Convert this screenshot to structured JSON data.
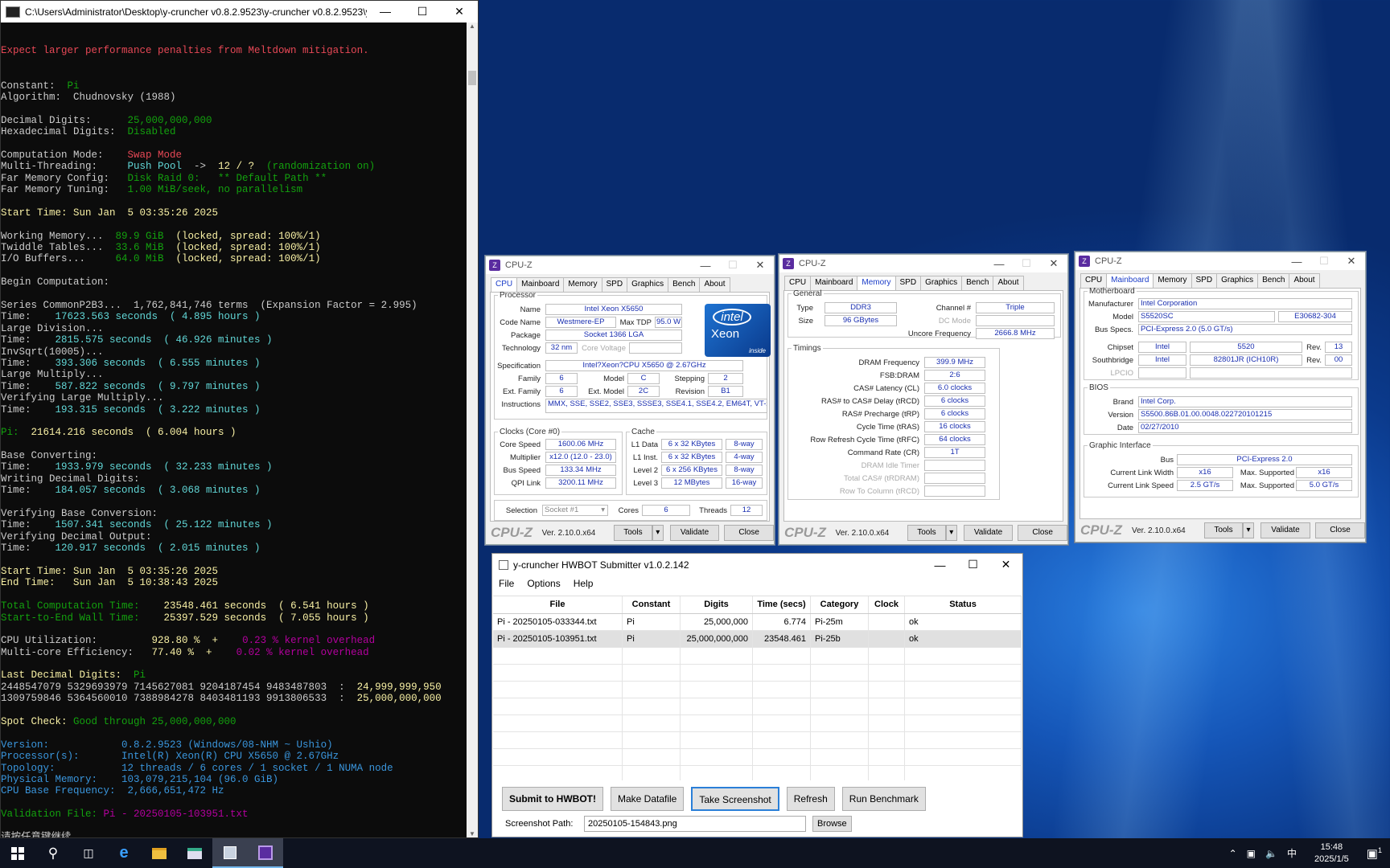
{
  "console": {
    "title": "C:\\Users\\Administrator\\Desktop\\y-cruncher v0.8.2.9523\\y-cruncher v0.8.2.9523\\y-cr...",
    "lines": [
      [
        [
          "",
          "w"
        ]
      ],
      [
        [
          "Expect larger performance penalties from Meltdown mitigation.",
          "r"
        ]
      ],
      [
        [
          "",
          "w"
        ]
      ],
      [
        [
          "",
          "w"
        ]
      ],
      [
        [
          "Constant:  ",
          "w"
        ],
        [
          "Pi",
          "g"
        ]
      ],
      [
        [
          "Algorithm:  Chudnovsky (1988)",
          "w"
        ]
      ],
      [
        [
          "",
          "w"
        ]
      ],
      [
        [
          "Decimal Digits:      ",
          "w"
        ],
        [
          "25,000,000,000",
          "g"
        ]
      ],
      [
        [
          "Hexadecimal Digits:  ",
          "w"
        ],
        [
          "Disabled",
          "g"
        ]
      ],
      [
        [
          "",
          "w"
        ]
      ],
      [
        [
          "Computation Mode:    ",
          "w"
        ],
        [
          "Swap Mode",
          "r"
        ]
      ],
      [
        [
          "Multi-Threading:     ",
          "w"
        ],
        [
          "Push Pool",
          "c"
        ],
        [
          "  ->  ",
          "w"
        ],
        [
          "12 / ?",
          "y"
        ],
        [
          "  (randomization on)",
          "g"
        ]
      ],
      [
        [
          "Far Memory Config:   ",
          "w"
        ],
        [
          "Disk Raid 0:   ** Default Path **",
          "g"
        ]
      ],
      [
        [
          "Far Memory Tuning:   ",
          "w"
        ],
        [
          "1.00 MiB/seek, no parallelism",
          "g"
        ]
      ],
      [
        [
          "",
          "w"
        ]
      ],
      [
        [
          "Start Time: Sun Jan  5 03:35:26 2025",
          "y"
        ]
      ],
      [
        [
          "",
          "w"
        ]
      ],
      [
        [
          "Working Memory...  ",
          "w"
        ],
        [
          "89.9 GiB",
          "g"
        ],
        [
          "  (locked, spread: 100%/1)",
          "y"
        ]
      ],
      [
        [
          "Twiddle Tables...  ",
          "w"
        ],
        [
          "33.6 MiB",
          "g"
        ],
        [
          "  (locked, spread: 100%/1)",
          "y"
        ]
      ],
      [
        [
          "I/O Buffers...     ",
          "w"
        ],
        [
          "64.0 MiB",
          "g"
        ],
        [
          "  (locked, spread: 100%/1)",
          "y"
        ]
      ],
      [
        [
          "",
          "w"
        ]
      ],
      [
        [
          "Begin Computation:",
          "w"
        ]
      ],
      [
        [
          "",
          "w"
        ]
      ],
      [
        [
          "Series CommonP2B3...  1,762,841,746 terms  (Expansion Factor = 2.995)",
          "w"
        ]
      ],
      [
        [
          "Time:    ",
          "w"
        ],
        [
          "17623.563 seconds  ( 4.895 hours )",
          "c"
        ]
      ],
      [
        [
          "Large Division...",
          "w"
        ]
      ],
      [
        [
          "Time:    ",
          "w"
        ],
        [
          "2815.575 seconds  ( 46.926 minutes )",
          "c"
        ]
      ],
      [
        [
          "InvSqrt(10005)...",
          "w"
        ]
      ],
      [
        [
          "Time:    ",
          "w"
        ],
        [
          "393.306 seconds  ( 6.555 minutes )",
          "c"
        ]
      ],
      [
        [
          "Large Multiply...",
          "w"
        ]
      ],
      [
        [
          "Time:    ",
          "w"
        ],
        [
          "587.822 seconds  ( 9.797 minutes )",
          "c"
        ]
      ],
      [
        [
          "Verifying Large Multiply...",
          "w"
        ]
      ],
      [
        [
          "Time:    ",
          "w"
        ],
        [
          "193.315 seconds  ( 3.222 minutes )",
          "c"
        ]
      ],
      [
        [
          "",
          "w"
        ]
      ],
      [
        [
          "Pi:  ",
          "g"
        ],
        [
          "21614.216 seconds  ( 6.004 hours )",
          "y"
        ]
      ],
      [
        [
          "",
          "w"
        ]
      ],
      [
        [
          "Base Converting:",
          "w"
        ]
      ],
      [
        [
          "Time:    ",
          "w"
        ],
        [
          "1933.979 seconds  ( 32.233 minutes )",
          "c"
        ]
      ],
      [
        [
          "Writing Decimal Digits:",
          "w"
        ]
      ],
      [
        [
          "Time:    ",
          "w"
        ],
        [
          "184.057 seconds  ( 3.068 minutes )",
          "c"
        ]
      ],
      [
        [
          "",
          "w"
        ]
      ],
      [
        [
          "Verifying Base Conversion:",
          "w"
        ]
      ],
      [
        [
          "Time:    ",
          "w"
        ],
        [
          "1507.341 seconds  ( 25.122 minutes )",
          "c"
        ]
      ],
      [
        [
          "Verifying Decimal Output:",
          "w"
        ]
      ],
      [
        [
          "Time:    ",
          "w"
        ],
        [
          "120.917 seconds  ( 2.015 minutes )",
          "c"
        ]
      ],
      [
        [
          "",
          "w"
        ]
      ],
      [
        [
          "Start Time: Sun Jan  5 03:35:26 2025",
          "y"
        ]
      ],
      [
        [
          "End Time:   Sun Jan  5 10:38:43 2025",
          "y"
        ]
      ],
      [
        [
          "",
          "w"
        ]
      ],
      [
        [
          "Total Computation Time:    ",
          "g"
        ],
        [
          "23548.461 seconds  ( 6.541 hours )",
          "y"
        ]
      ],
      [
        [
          "Start-to-End Wall Time:    ",
          "g"
        ],
        [
          "25397.529 seconds  ( 7.055 hours )",
          "y"
        ]
      ],
      [
        [
          "",
          "w"
        ]
      ],
      [
        [
          "CPU Utilization:         ",
          "w"
        ],
        [
          "928.80 %  +    ",
          "y"
        ],
        [
          "0.23 % kernel overhead",
          "m"
        ]
      ],
      [
        [
          "Multi-core Efficiency:   ",
          "w"
        ],
        [
          "77.40 %  +    ",
          "y"
        ],
        [
          "0.02 % kernel overhead",
          "m"
        ]
      ],
      [
        [
          "",
          "w"
        ]
      ],
      [
        [
          "Last Decimal Digits:  ",
          "y"
        ],
        [
          "Pi",
          "g"
        ]
      ],
      [
        [
          "2448547079 5329693979 7145627081 9204187454 9483487803  :  ",
          "w"
        ],
        [
          "24,999,999,950",
          "y"
        ]
      ],
      [
        [
          "1309759846 5364560010 7388984278 8403481193 9913806533  :  ",
          "w"
        ],
        [
          "25,000,000,000",
          "y"
        ]
      ],
      [
        [
          "",
          "w"
        ]
      ],
      [
        [
          "Spot Check: ",
          "y"
        ],
        [
          "Good through 25,000,000,000",
          "g"
        ]
      ],
      [
        [
          "",
          "w"
        ]
      ],
      [
        [
          "Version:            0.8.2.9523 (Windows/08-NHM ~ Ushio)",
          "s"
        ]
      ],
      [
        [
          "Processor(s):       Intel(R) Xeon(R) CPU X5650 @ 2.67GHz",
          "s"
        ]
      ],
      [
        [
          "Topology:           12 threads / 6 cores / 1 socket / 1 NUMA node",
          "s"
        ]
      ],
      [
        [
          "Physical Memory:    103,079,215,104 (96.0 GiB)",
          "s"
        ]
      ],
      [
        [
          "CPU Base Frequency:  2,666,651,472 Hz",
          "s"
        ]
      ],
      [
        [
          "",
          "w"
        ]
      ],
      [
        [
          "Validation File: ",
          "g"
        ],
        [
          "Pi - 20250105-103951.txt",
          "m"
        ]
      ],
      [
        [
          "",
          "w"
        ]
      ],
      [
        [
          "请按任意键继续. . .",
          "w"
        ]
      ]
    ]
  },
  "cpuz_cpu": {
    "title": "CPU-Z",
    "tabs": [
      "CPU",
      "Mainboard",
      "Memory",
      "SPD",
      "Graphics",
      "Bench",
      "About"
    ],
    "processor_legend": "Processor",
    "name_label": "Name",
    "name": "Intel Xeon X5650",
    "codename_label": "Code Name",
    "codename": "Westmere-EP",
    "maxtdp_label": "Max TDP",
    "maxtdp": "95.0 W",
    "package_label": "Package",
    "package": "Socket 1366 LGA",
    "tech_label": "Technology",
    "tech": "32 nm",
    "corevolt_label": "Core Voltage",
    "spec_label": "Specification",
    "spec": "Intel?Xeon?CPU       X5650  @ 2.67GHz",
    "family_label": "Family",
    "family": "6",
    "model_label": "Model",
    "model": "C",
    "stepping_label": "Stepping",
    "stepping": "2",
    "extfamily_label": "Ext. Family",
    "extfamily": "6",
    "extmodel_label": "Ext. Model",
    "extmodel": "2C",
    "revision_label": "Revision",
    "revision": "B1",
    "instr_label": "Instructions",
    "instr": "MMX, SSE, SSE2, SSE3, SSSE3, SSE4.1, SSE4.2, EM64T, VT-x",
    "clocks_legend": "Clocks (Core #0)",
    "corespeed_label": "Core Speed",
    "corespeed": "1600.06 MHz",
    "multiplier_label": "Multiplier",
    "multiplier": "x12.0 (12.0 - 23.0)",
    "busspeed_label": "Bus Speed",
    "busspeed": "133.34 MHz",
    "qpi_label": "QPI Link",
    "qpi": "3200.11 MHz",
    "cache_legend": "Cache",
    "l1d_label": "L1 Data",
    "l1d": "6 x 32 KBytes",
    "l1d_w": "8-way",
    "l1i_label": "L1 Inst.",
    "l1i": "6 x 32 KBytes",
    "l1i_w": "4-way",
    "l2_label": "Level 2",
    "l2": "6 x 256 KBytes",
    "l2_w": "8-way",
    "l3_label": "Level 3",
    "l3": "12 MBytes",
    "l3_w": "16-way",
    "selection_label": "Selection",
    "selection": "Socket #1",
    "cores_label": "Cores",
    "cores": "6",
    "threads_label": "Threads",
    "threads": "12",
    "logo_line1": "intel",
    "logo_line2": "Xeon",
    "logo_line3": "inside"
  },
  "cpuz_mem": {
    "title": "CPU-Z",
    "tabs": [
      "CPU",
      "Mainboard",
      "Memory",
      "SPD",
      "Graphics",
      "Bench",
      "About"
    ],
    "general_legend": "General",
    "type_label": "Type",
    "type": "DDR3",
    "size_label": "Size",
    "size": "96 GBytes",
    "channel_label": "Channel #",
    "channel": "Triple",
    "dcmode_label": "DC Mode",
    "uncore_label": "Uncore Frequency",
    "uncore": "2666.8 MHz",
    "timings_legend": "Timings",
    "t": [
      [
        "DRAM Frequency",
        "399.9 MHz"
      ],
      [
        "FSB:DRAM",
        "2:6"
      ],
      [
        "CAS# Latency (CL)",
        "6.0 clocks"
      ],
      [
        "RAS# to CAS# Delay (tRCD)",
        "6 clocks"
      ],
      [
        "RAS# Precharge (tRP)",
        "6 clocks"
      ],
      [
        "Cycle Time (tRAS)",
        "16 clocks"
      ],
      [
        "Row Refresh Cycle Time (tRFC)",
        "64 clocks"
      ],
      [
        "Command Rate (CR)",
        "1T"
      ],
      [
        "DRAM Idle Timer",
        ""
      ],
      [
        "Total CAS# (tRDRAM)",
        ""
      ],
      [
        "Row To Column (tRCD)",
        ""
      ]
    ]
  },
  "cpuz_mb": {
    "title": "CPU-Z",
    "tabs": [
      "CPU",
      "Mainboard",
      "Memory",
      "SPD",
      "Graphics",
      "Bench",
      "About"
    ],
    "mb_legend": "Motherboard",
    "manufacturer_label": "Manufacturer",
    "manufacturer": "Intel Corporation",
    "model_label": "Model",
    "model": "S5520SC",
    "model2": "E30682-304",
    "busspecs_label": "Bus Specs.",
    "busspecs": "PCI-Express 2.0 (5.0 GT/s)",
    "chipset_label": "Chipset",
    "chipset_vendor": "Intel",
    "chipset": "5520",
    "chipset_rev_label": "Rev.",
    "chipset_rev": "13",
    "south_label": "Southbridge",
    "south_vendor": "Intel",
    "south": "82801JR (ICH10R)",
    "south_rev_label": "Rev.",
    "south_rev": "00",
    "lpcio_label": "LPCIO",
    "bios_legend": "BIOS",
    "brand_label": "Brand",
    "brand": "Intel Corp.",
    "version_label": "Version",
    "version": "S5500.86B.01.00.0048.022720101215",
    "date_label": "Date",
    "date": "02/27/2010",
    "gi_legend": "Graphic Interface",
    "bus_label": "Bus",
    "bus": "PCI-Express 2.0",
    "clw_label": "Current Link Width",
    "clw": "x16",
    "msw_label": "Max. Supported",
    "msw": "x16",
    "cls_label": "Current Link Speed",
    "cls": "2.5 GT/s",
    "mss_label": "Max. Supported",
    "mss": "5.0 GT/s"
  },
  "cpuz_footer": {
    "brand": "CPU-Z",
    "version": "Ver. 2.10.0.x64",
    "tools": "Tools",
    "validate": "Validate",
    "close": "Close"
  },
  "submitter": {
    "title": "y-cruncher HWBOT Submitter v1.0.2.142",
    "menu": [
      "File",
      "Options",
      "Help"
    ],
    "columns": [
      "File",
      "Constant",
      "Digits",
      "Time (secs)",
      "Category",
      "Clock",
      "Status"
    ],
    "rows": [
      [
        "Pi - 20250105-033344.txt",
        "Pi",
        "25,000,000",
        "6.774",
        "Pi-25m",
        "",
        "ok"
      ],
      [
        "Pi - 20250105-103951.txt",
        "Pi",
        "25,000,000,000",
        "23548.461",
        "Pi-25b",
        "",
        "ok"
      ]
    ],
    "buttons": {
      "submit": "Submit to HWBOT!",
      "datafile": "Make Datafile",
      "screenshot": "Take Screenshot",
      "refresh": "Refresh",
      "benchmark": "Run Benchmark"
    },
    "path_label": "Screenshot Path:",
    "path_value": "20250105-154843.png",
    "browse": "Browse"
  },
  "taskbar": {
    "time": "15:48",
    "date": "2025/1/5",
    "ime": "中",
    "notif": "1"
  }
}
